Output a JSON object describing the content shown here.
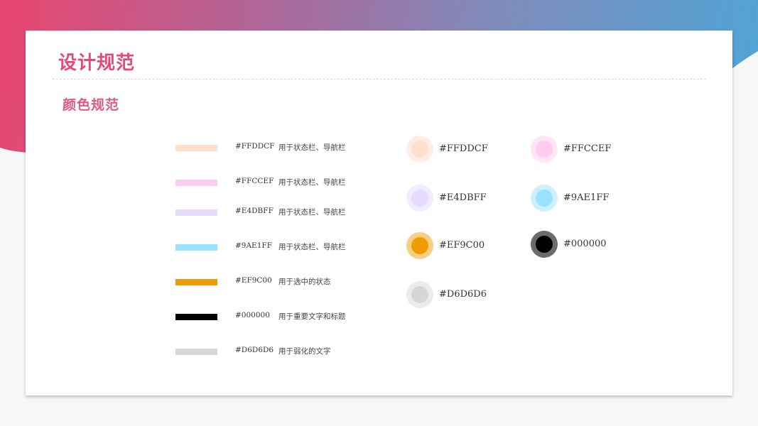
{
  "page": {
    "title": "设计规范",
    "subtitle": "颜色规范",
    "accent_color": "#e54a76"
  },
  "swatches": [
    {
      "color": "#FFDDCF",
      "hex": "#FFDDCF",
      "usage": "用于状态栏、导航栏"
    },
    {
      "color": "#FFCCEF",
      "hex": "#FFCCEF",
      "usage": "用于状态栏、导航栏"
    },
    {
      "color": "#E4DBFF",
      "hex": "#E4DBFF",
      "usage": "用于状态栏、导航栏"
    },
    {
      "color": "#9AE1FF",
      "hex": "#9AE1FF",
      "usage": "用于状态栏、导航栏"
    },
    {
      "color": "#EF9C00",
      "hex": "#EF9C00",
      "usage": "用于选中的状态"
    },
    {
      "color": "#000000",
      "hex": "#000000",
      "usage": "用于重要文字和标题"
    },
    {
      "color": "#D6D6D6",
      "hex": "#D6D6D6",
      "usage": "用于弱化的文字"
    }
  ],
  "dots_left": [
    {
      "color": "#FFDDCF",
      "ring": "#FFEDE5",
      "hex": "#FFDDCF"
    },
    {
      "color": "#E4DBFF",
      "ring": "#F1ECFF",
      "hex": "#E4DBFF"
    },
    {
      "color": "#EF9C00",
      "ring": "#F8CD84",
      "hex": "#EF9C00"
    },
    {
      "color": "#D6D6D6",
      "ring": "#EBEBEB",
      "hex": "#D6D6D6"
    }
  ],
  "dots_right": [
    {
      "color": "#FFCCEF",
      "ring": "#FFE5F7",
      "hex": "#FFCCEF"
    },
    {
      "color": "#9AE1FF",
      "ring": "#CDF0FF",
      "hex": "#9AE1FF"
    },
    {
      "color": "#000000",
      "ring": "#6B6B6B",
      "hex": "#000000"
    }
  ]
}
